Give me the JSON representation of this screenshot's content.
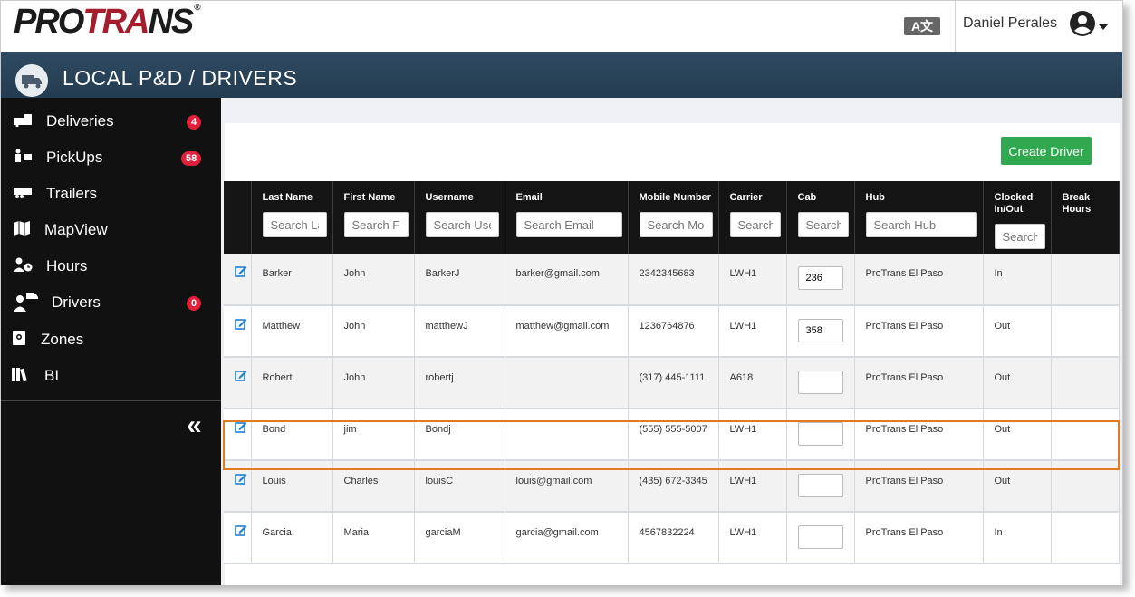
{
  "brand": {
    "logo_prefix": "PRO",
    "logo_accent": "TRA",
    "logo_suffix": "NS",
    "logo_reg": "®",
    "accent_color": "#a51d2d"
  },
  "topbar": {
    "language_icon": "translate-icon",
    "language_text": "A文",
    "user_name": "Daniel Perales"
  },
  "header": {
    "title": "LOCAL P&D / DRIVERS",
    "icon": "truck-icon"
  },
  "sidebar": {
    "items": [
      {
        "label": "Deliveries",
        "badge": "4"
      },
      {
        "label": "PickUps",
        "badge": "58"
      },
      {
        "label": "Trailers",
        "badge": ""
      },
      {
        "label": "MapView",
        "badge": ""
      },
      {
        "label": "Hours",
        "badge": ""
      },
      {
        "label": "Drivers",
        "badge": "0"
      },
      {
        "label": "Zones",
        "badge": ""
      },
      {
        "label": "BI",
        "badge": ""
      }
    ],
    "collapse_glyph": "«"
  },
  "actions": {
    "create_driver": "Create Driver"
  },
  "table": {
    "columns": [
      {
        "label": "Last Name",
        "placeholder": "Search Last Name"
      },
      {
        "label": "First Name",
        "placeholder": "Search First Name"
      },
      {
        "label": "Username",
        "placeholder": "Search Username"
      },
      {
        "label": "Email",
        "placeholder": "Search Email"
      },
      {
        "label": "Mobile Number",
        "placeholder": "Search Mobile Number"
      },
      {
        "label": "Carrier",
        "placeholder": "Search Carrier"
      },
      {
        "label": "Cab",
        "placeholder": "Search Cab"
      },
      {
        "label": "Hub",
        "placeholder": "Search Hub"
      },
      {
        "label": "Clocked In/Out",
        "placeholder": "Search Clocked"
      },
      {
        "label": "Break Hours",
        "placeholder": ""
      }
    ],
    "rows": [
      {
        "last": "Barker",
        "first": "John",
        "user": "BarkerJ",
        "email": "barker@gmail.com",
        "mobile": "2342345683",
        "carrier": "LWH1",
        "cab": "236",
        "hub": "ProTrans El Paso",
        "clock": "In",
        "brk": ""
      },
      {
        "last": "Matthew",
        "first": "John",
        "user": "matthewJ",
        "email": "matthew@gmail.com",
        "mobile": "1236764876",
        "carrier": "LWH1",
        "cab": "358",
        "hub": "ProTrans El Paso",
        "clock": "Out",
        "brk": ""
      },
      {
        "last": "Robert",
        "first": "John",
        "user": "robertj",
        "email": "",
        "mobile": "(317) 445-1111",
        "carrier": "A618",
        "cab": "",
        "hub": "ProTrans El Paso",
        "clock": "Out",
        "brk": ""
      },
      {
        "last": "Bond",
        "first": "jim",
        "user": "Bondj",
        "email": "",
        "mobile": "(555) 555-5007",
        "carrier": "LWH1",
        "cab": "",
        "hub": "ProTrans El Paso",
        "clock": "Out",
        "brk": ""
      },
      {
        "last": "Louis",
        "first": "Charles",
        "user": "louisC",
        "email": "louis@gmail.com",
        "mobile": "(435) 672-3345",
        "carrier": "LWH1",
        "cab": "",
        "hub": "ProTrans El Paso",
        "clock": "Out",
        "brk": ""
      },
      {
        "last": "Garcia",
        "first": "Maria",
        "user": "garciaM",
        "email": "garcia@gmail.com",
        "mobile": "4567832224",
        "carrier": "LWH1",
        "cab": "",
        "hub": "ProTrans El Paso",
        "clock": "In",
        "brk": ""
      }
    ],
    "highlighted_row_color": "#e07b1f",
    "edit_icon": "edit-icon"
  }
}
